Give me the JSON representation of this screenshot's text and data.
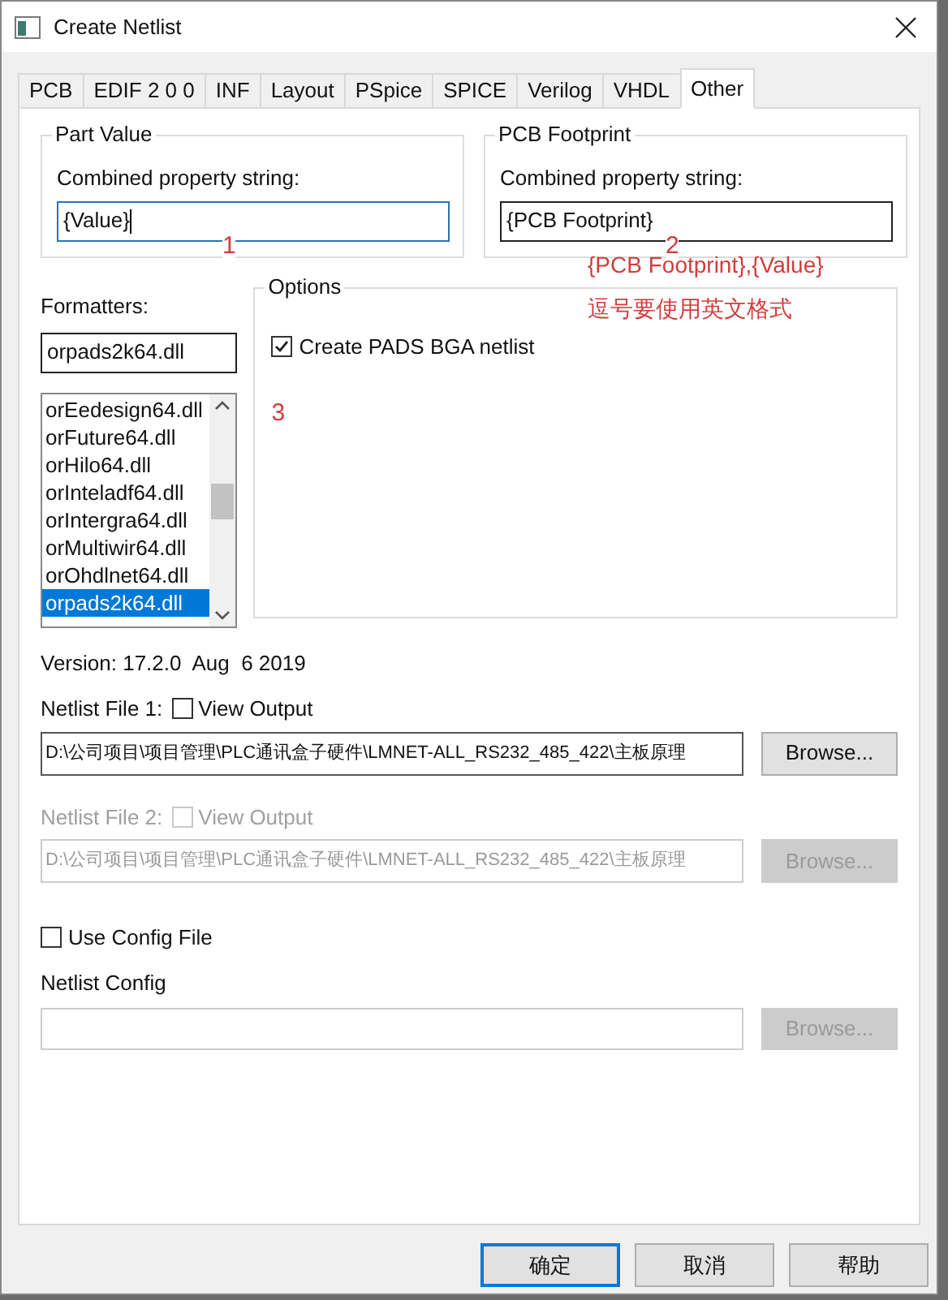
{
  "window": {
    "title": "Create Netlist"
  },
  "tabs": [
    {
      "label": "PCB",
      "selected": false
    },
    {
      "label": "EDIF 2 0 0",
      "selected": false
    },
    {
      "label": "INF",
      "selected": false
    },
    {
      "label": "Layout",
      "selected": false
    },
    {
      "label": "PSpice",
      "selected": false
    },
    {
      "label": "SPICE",
      "selected": false
    },
    {
      "label": "Verilog",
      "selected": false
    },
    {
      "label": "VHDL",
      "selected": false
    },
    {
      "label": "Other",
      "selected": true
    }
  ],
  "property_groups": [
    {
      "title": "Part Value",
      "label": "Combined property string:",
      "value": "{Value}",
      "focused": true,
      "annotation": "1"
    },
    {
      "title": "PCB Footprint",
      "label": "Combined property string:",
      "value": "{PCB Footprint}",
      "focused": false,
      "annotation": "2"
    }
  ],
  "notes": [
    "{PCB Footprint},{Value}",
    "逗号要使用英文格式"
  ],
  "formatters": {
    "label": "Formatters:",
    "value": "orpads2k64.dll",
    "items": [
      {
        "label": "orEedesign64.dll",
        "selected": false
      },
      {
        "label": "orFuture64.dll",
        "selected": false
      },
      {
        "label": "orHilo64.dll",
        "selected": false
      },
      {
        "label": "orInteladf64.dll",
        "selected": false
      },
      {
        "label": "orIntergra64.dll",
        "selected": false
      },
      {
        "label": "orMultiwir64.dll",
        "selected": false
      },
      {
        "label": "orOhdlnet64.dll",
        "selected": false
      },
      {
        "label": "orpads2k64.dll",
        "selected": true
      }
    ]
  },
  "options": {
    "title": "Options",
    "checkboxes": [
      {
        "label": "Create PADS BGA netlist",
        "checked": true
      }
    ],
    "annotation": "3"
  },
  "version": "Version: 17.2.0  Aug  6 2019",
  "netlist_files": [
    {
      "label": "Netlist File 1:",
      "view_output": {
        "label": "View Output",
        "checked": false
      },
      "path": "D:\\公司项目\\项目管理\\PLC通讯盒子硬件\\LMNET-ALL_RS232_485_422\\主板原理",
      "button": "Browse...",
      "disabled": false
    },
    {
      "label": "Netlist File 2:",
      "view_output": {
        "label": "View Output",
        "checked": false
      },
      "path": "D:\\公司项目\\项目管理\\PLC通讯盒子硬件\\LMNET-ALL_RS232_485_422\\主板原理",
      "button": "Browse...",
      "disabled": true
    }
  ],
  "use_config": {
    "label": "Use Config File",
    "checked": false
  },
  "netlist_config": {
    "label": "Netlist Config",
    "button": "Browse...",
    "disabled": true
  },
  "buttons": [
    {
      "label": "确定",
      "default": true
    },
    {
      "label": "取消",
      "default": false
    },
    {
      "label": "帮助",
      "default": false
    }
  ]
}
